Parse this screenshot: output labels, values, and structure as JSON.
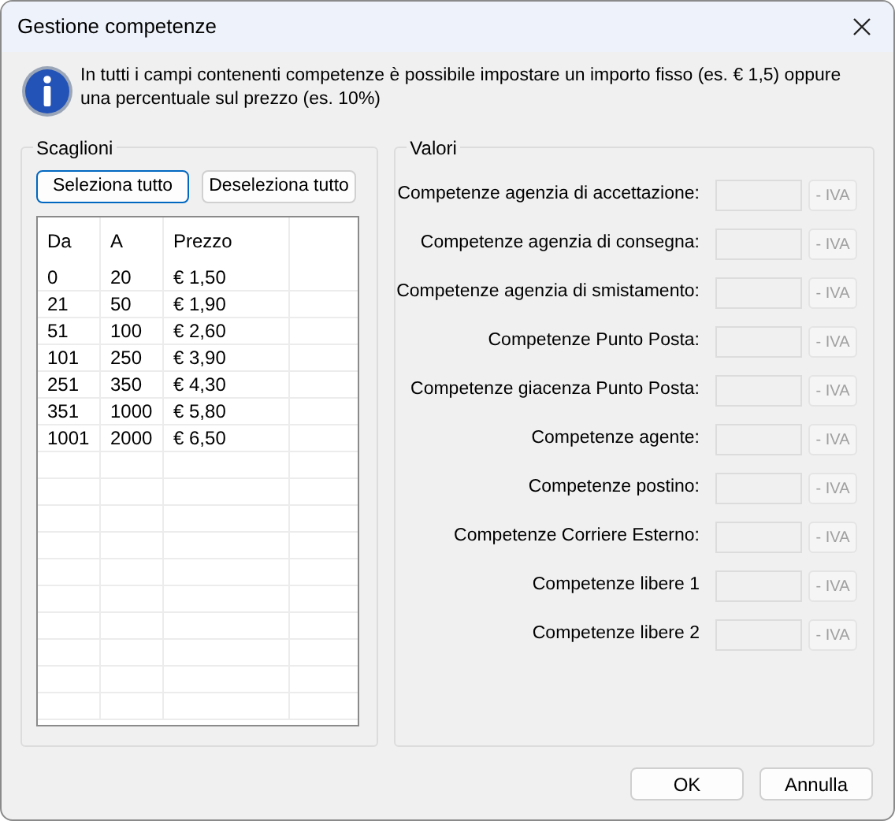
{
  "window": {
    "title": "Gestione competenze"
  },
  "info": "In tutti i campi contenenti competenze è possibile impostare un importo fisso (es. € 1,5) oppure una percentuale sul prezzo (es. 10%)",
  "scaglioni": {
    "title": "Scaglioni",
    "buttons": [
      {
        "label": "Seleziona tutto",
        "focused": true
      },
      {
        "label": "Deseleziona tutto",
        "focused": false
      }
    ],
    "columns": [
      "Da",
      "A",
      "Prezzo"
    ],
    "rows": [
      [
        "0",
        "20",
        "€ 1,50"
      ],
      [
        "21",
        "50",
        "€ 1,90"
      ],
      [
        "51",
        "100",
        "€ 2,60"
      ],
      [
        "101",
        "250",
        "€ 3,90"
      ],
      [
        "251",
        "350",
        "€ 4,30"
      ],
      [
        "351",
        "1000",
        "€ 5,80"
      ],
      [
        "1001",
        "2000",
        "€ 6,50"
      ]
    ]
  },
  "valori": {
    "title": "Valori",
    "rows": [
      {
        "label": "Competenze agenzia di accettazione:",
        "button": "- IVA",
        "disabled": true
      },
      {
        "label": "Competenze agenzia di consegna:",
        "button": "- IVA",
        "disabled": true
      },
      {
        "label": "Competenze agenzia di smistamento:",
        "button": "- IVA",
        "disabled": true
      },
      {
        "label": "Competenze Punto Posta:",
        "button": "- IVA",
        "disabled": true
      },
      {
        "label": "Competenze giacenza Punto Posta:",
        "button": "- IVA",
        "disabled": true
      },
      {
        "label": "Competenze agente:",
        "button": "- IVA",
        "disabled": true
      },
      {
        "label": "Competenze postino:",
        "button": "- IVA",
        "disabled": true
      },
      {
        "label": "Competenze Corriere Esterno:",
        "button": "- IVA",
        "disabled": true
      },
      {
        "label": "Competenze libere 1",
        "button": "- IVA",
        "disabled": true
      },
      {
        "label": "Competenze libere 2",
        "button": "- IVA",
        "disabled": true
      }
    ]
  },
  "buttons": [
    "OK",
    "Annulla"
  ]
}
